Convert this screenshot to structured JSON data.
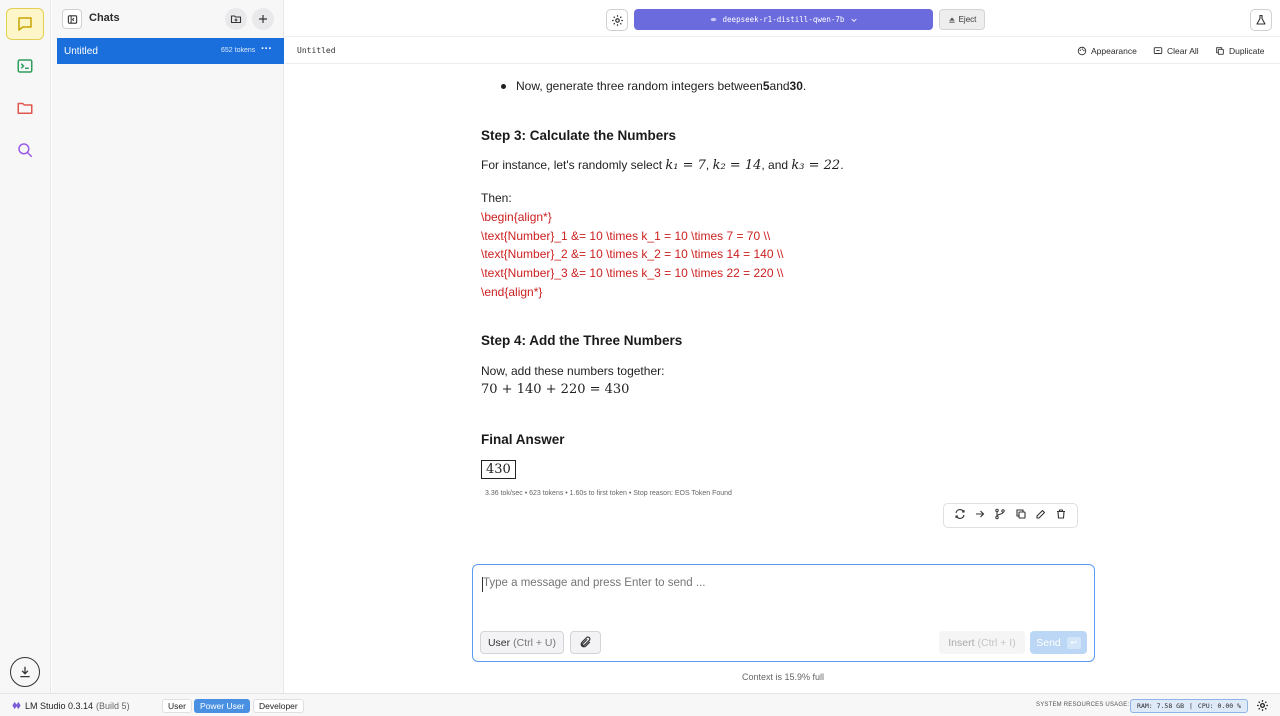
{
  "sidebar": {
    "title": "Chats",
    "chat_items": [
      {
        "name": "Untitled",
        "tokens": "652 tokens",
        "more": "···"
      }
    ]
  },
  "topbar": {
    "model_name": "deepseek-r1-distill-qwen-7b",
    "eject_label": "Eject"
  },
  "chat": {
    "title": "Untitled",
    "actions": {
      "appearance": "Appearance",
      "clear_all": "Clear All",
      "duplicate": "Duplicate"
    }
  },
  "message": {
    "bullet_before": "Now, generate three random integers between ",
    "bullet_num1": "5",
    "bullet_mid": " and ",
    "bullet_num2": "30",
    "bullet_after": ".",
    "step3_heading": "Step 3: Calculate the Numbers",
    "step3_intro": "For instance, let's randomly select ",
    "k1_math": "k₁ = 7",
    "k2_math": "k₂ = 14",
    "k3_math": "k₃ = 22",
    "comma1": ", ",
    "and_text": ", and ",
    "period": ".",
    "then_label": "Then:",
    "latex_lines": [
      "\\begin{align*}",
      "\\text{Number}_1 &= 10 \\times k_1 = 10 \\times 7 = 70 \\\\",
      "\\text{Number}_2 &= 10 \\times k_2 = 10 \\times 14 = 140 \\\\",
      "\\text{Number}_3 &= 10 \\times k_3 = 10 \\times 22 = 220 \\\\",
      "\\end{align*}"
    ],
    "step4_heading": "Step 4: Add the Three Numbers",
    "step4_intro": "Now, add these numbers together:",
    "sum_math": "70 + 140 + 220 = 430",
    "final_heading": "Final Answer",
    "final_answer": "430",
    "stats": "3.36 tok/sec  •  623 tokens  •  1.60s to first token  •  Stop reason: EOS Token Found"
  },
  "composer": {
    "placeholder": "Type a message and press Enter to send ...",
    "user_label": "User",
    "user_hint": "(Ctrl + U)",
    "insert_label": "Insert",
    "insert_hint": "(Ctrl + I)",
    "send_label": "Send",
    "send_key": "↩",
    "context": "Context is 15.9% full"
  },
  "statusbar": {
    "app_name": "LM Studio 0.3.14",
    "build": "(Build 5)",
    "modes": [
      "User",
      "Power User",
      "Developer"
    ],
    "active_mode": "Power User",
    "sys_label": "SYSTEM RESOURCES USAGE:",
    "ram": "RAM: 7.58 GB",
    "cpu": "CPU: 0.00 %"
  },
  "colors": {
    "accent": "#1b6fdc",
    "model_button": "#6b6bde",
    "latex_red": "#cc1f1f",
    "active_rail": "#fdf6c9"
  }
}
